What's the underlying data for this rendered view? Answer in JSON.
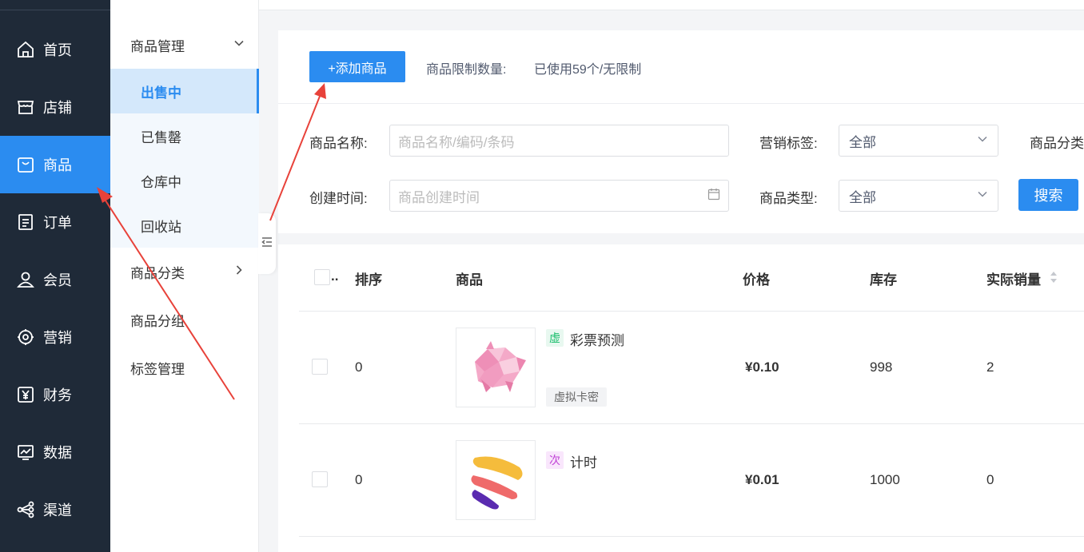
{
  "nav": {
    "items": [
      {
        "label": "首页",
        "icon": "home-icon"
      },
      {
        "label": "店铺",
        "icon": "store-icon"
      },
      {
        "label": "商品",
        "icon": "bag-icon"
      },
      {
        "label": "订单",
        "icon": "order-icon"
      },
      {
        "label": "会员",
        "icon": "user-icon"
      },
      {
        "label": "营销",
        "icon": "gear-icon"
      },
      {
        "label": "财务",
        "icon": "yen-icon"
      },
      {
        "label": "数据",
        "icon": "chart-icon"
      },
      {
        "label": "渠道",
        "icon": "share-icon"
      }
    ],
    "active_index": 2
  },
  "subnav": {
    "group_goods": "商品管理",
    "items": [
      "出售中",
      "已售罄",
      "仓库中",
      "回收站"
    ],
    "group_category": "商品分类",
    "group_goods_group": "商品分组",
    "group_tags": "标签管理"
  },
  "toolbar": {
    "add_label": "+添加商品",
    "limit_label": "商品限制数量:",
    "limit_value": "已使用59个/无限制"
  },
  "filters": {
    "name_label": "商品名称:",
    "name_placeholder": "商品名称/编码/条码",
    "tag_label": "营销标签:",
    "tag_value": "全部",
    "category_label": "商品分类",
    "time_label": "创建时间:",
    "time_placeholder": "商品创建时间",
    "type_label": "商品类型:",
    "type_value": "全部",
    "search_label": "搜索"
  },
  "table": {
    "headers": {
      "select": "..",
      "sort": "排序",
      "goods": "商品",
      "price": "价格",
      "stock": "库存",
      "sales": "实际销量"
    },
    "rows": [
      {
        "sort": "0",
        "tag": "虚",
        "name": "彩票预测",
        "badge": "虚拟卡密",
        "price": "¥0.10",
        "stock": "998",
        "sales": "2",
        "tag_color": "#19be6b",
        "tag_bg": "#e8f8f0"
      },
      {
        "sort": "0",
        "tag": "次",
        "name": "计时",
        "badge": "",
        "price": "¥0.01",
        "stock": "1000",
        "sales": "0",
        "tag_color": "#c041d6",
        "tag_bg": "#f9e6fc"
      }
    ]
  },
  "colors": {
    "primary": "#2b8cf0",
    "sidebar": "#1f2a38",
    "annotation_arrow": "#e8423a"
  }
}
